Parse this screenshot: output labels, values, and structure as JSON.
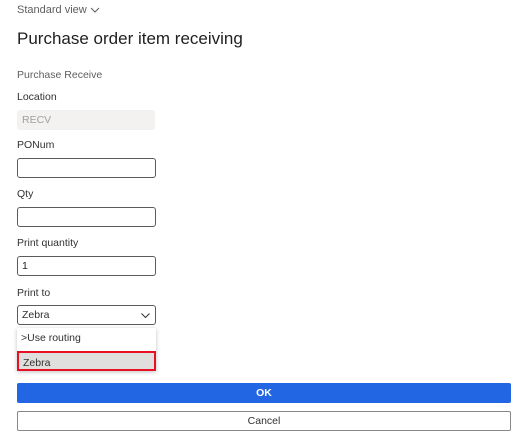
{
  "header": {
    "view_selector_label": "Standard view",
    "page_title": "Purchase order item receiving"
  },
  "form": {
    "section_label": "Purchase Receive",
    "location": {
      "label": "Location",
      "value": "RECV"
    },
    "ponum": {
      "label": "PONum",
      "value": ""
    },
    "qty": {
      "label": "Qty",
      "value": ""
    },
    "print_quantity": {
      "label": "Print quantity",
      "value": "1"
    },
    "print_to": {
      "label": "Print to",
      "selected": "Zebra",
      "options": [
        ">Use routing",
        "Zebra"
      ]
    }
  },
  "actions": {
    "ok_label": "OK",
    "cancel_label": "Cancel"
  },
  "colors": {
    "primary": "#2266e3",
    "highlight_border": "#e81123"
  },
  "icons": {
    "view_selector": "chevron-down-icon",
    "select_arrow": "chevron-down-icon"
  }
}
